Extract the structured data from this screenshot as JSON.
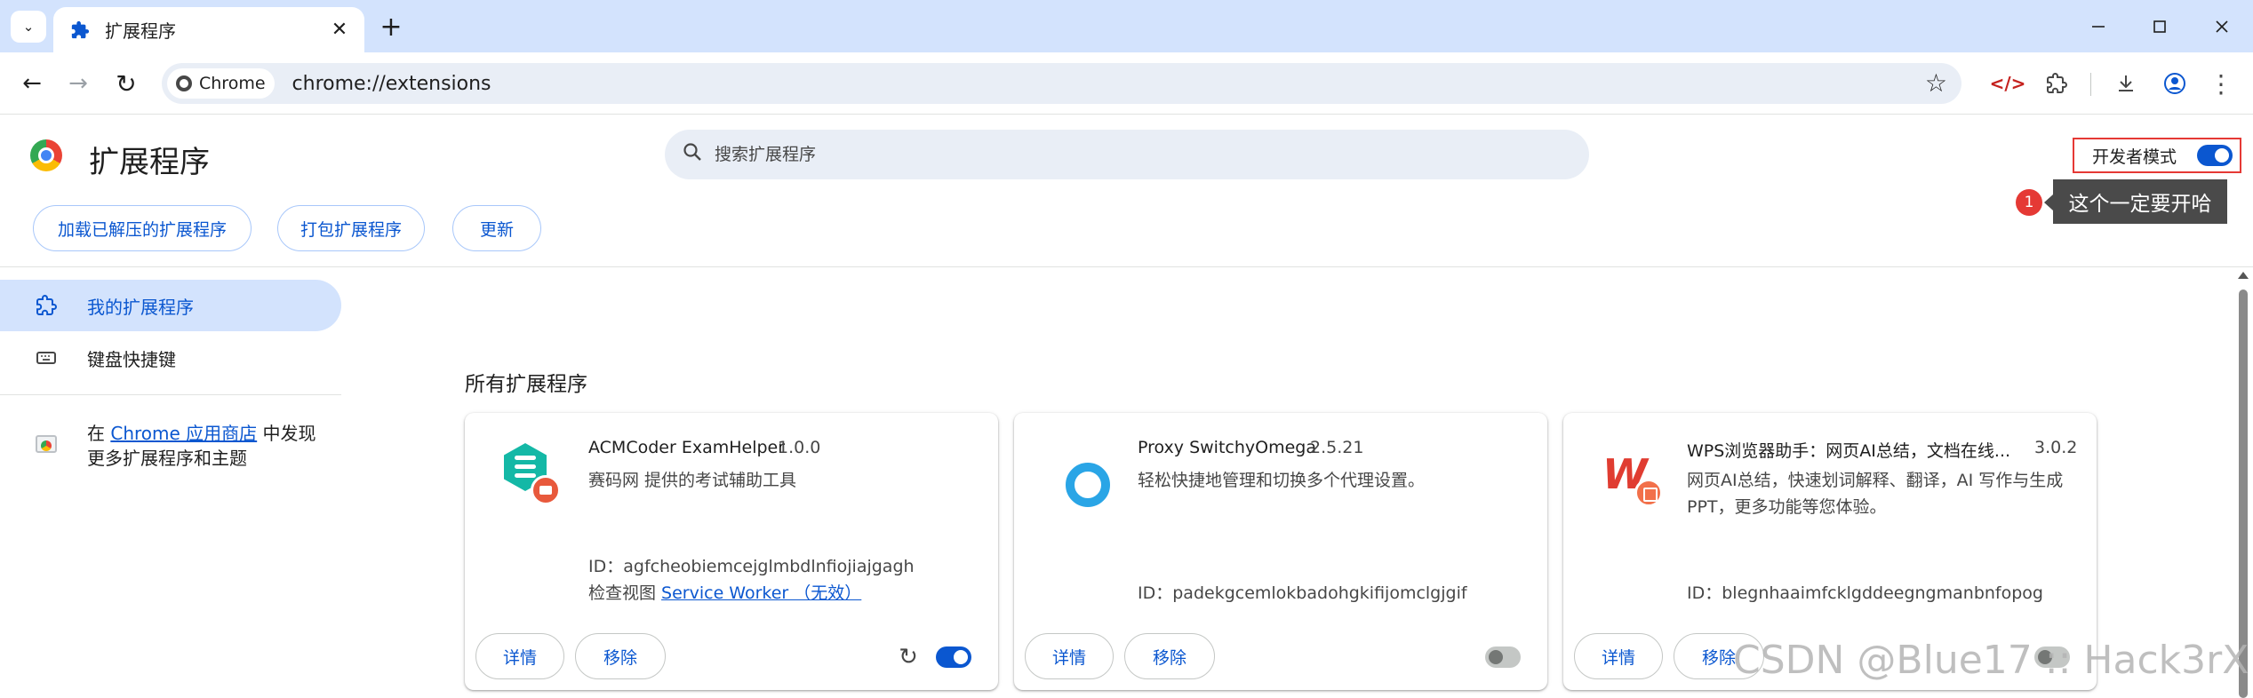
{
  "browser": {
    "tab": {
      "title": "扩展程序",
      "favicon": "puzzle-icon"
    },
    "omnibox": {
      "site_chip": "Chrome",
      "url": "chrome://extensions"
    },
    "icons": [
      "devtools-icon",
      "extensions-icon",
      "download-icon",
      "profile-icon",
      "menu-icon"
    ]
  },
  "header": {
    "title": "扩展程序",
    "search_placeholder": "搜索扩展程序",
    "dev_mode_label": "开发者模式",
    "dev_mode_enabled": true,
    "buttons": {
      "load_unpacked": "加载已解压的扩展程序",
      "pack": "打包扩展程序",
      "update": "更新"
    }
  },
  "annotation": {
    "number": "1",
    "text": "这个一定要开哈",
    "color": "#e53935"
  },
  "sidebar": {
    "items": [
      {
        "label": "我的扩展程序",
        "selected": true,
        "icon": "extension-icon"
      },
      {
        "label": "键盘快捷键",
        "selected": false,
        "icon": "keyboard-icon"
      }
    ],
    "store": {
      "prefix": "在 ",
      "link": "Chrome 应用商店",
      "suffix": " 中发现更多扩展程序和主题"
    }
  },
  "main": {
    "section_title": "所有扩展程序",
    "extensions": [
      {
        "name": "ACMCoder ExamHelper",
        "version": "1.0.0",
        "description": "赛码网 提供的考试辅助工具",
        "id_text": "ID：agfcheobiemcejglmbdlnfiojiajgagh",
        "inspect_label": "检查视图 ",
        "inspect_link": "Service Worker （无效）",
        "details": "详情",
        "remove": "移除",
        "enabled": true,
        "icon": "acmcoder-icon"
      },
      {
        "name": "Proxy SwitchyOmega",
        "version": "2.5.21",
        "description": "轻松快捷地管理和切换多个代理设置。",
        "id_text": "ID：padekgcemlokbadohgkifijomclgjgif",
        "details": "详情",
        "remove": "移除",
        "enabled": false,
        "icon": "switchyomega-icon"
      },
      {
        "name": "WPS浏览器助手：网页AI总结，文档在线...",
        "version": "3.0.2",
        "description": "网页AI总结，快速划词解释、翻译，AI 写作与生成PPT，更多功能等您体验。",
        "id_text": "ID：blegnhaaimfcklgddeegngmanbnfopog",
        "details": "详情",
        "remove": "移除",
        "enabled": false,
        "icon": "wps-icon"
      }
    ]
  },
  "watermark": "CSDN @Blue17 :: Hack3rX",
  "colors": {
    "accent": "#0b57d0",
    "tabstrip": "#d3e3fd",
    "toggle_off": "#c4c7c5"
  }
}
